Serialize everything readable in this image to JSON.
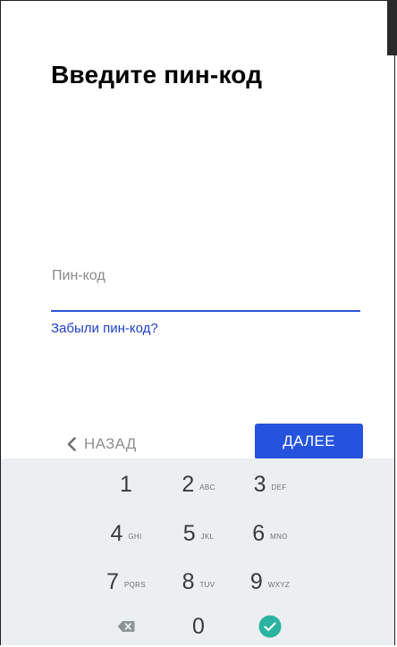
{
  "screen": {
    "title": "Введите пин-код"
  },
  "pin_field": {
    "label": "Пин-код",
    "value": ""
  },
  "forgot_link": "Забыли пин-код?",
  "nav": {
    "back_label": "НАЗАД",
    "next_label": "ДАЛЕЕ"
  },
  "keypad": {
    "keys": [
      {
        "digit": "1",
        "letters": ""
      },
      {
        "digit": "2",
        "letters": "ABC"
      },
      {
        "digit": "3",
        "letters": "DEF"
      },
      {
        "digit": "4",
        "letters": "GHI"
      },
      {
        "digit": "5",
        "letters": "JKL"
      },
      {
        "digit": "6",
        "letters": "MNO"
      },
      {
        "digit": "7",
        "letters": "PQRS"
      },
      {
        "digit": "8",
        "letters": "TUV"
      },
      {
        "digit": "9",
        "letters": "WXYZ"
      },
      {
        "digit": "0",
        "letters": ""
      }
    ],
    "delete_icon": "backspace-icon",
    "done_icon": "checkmark-circle-icon"
  },
  "colors": {
    "accent": "#2553e0",
    "link": "#1e40c9",
    "keypad_bg": "#eceff1",
    "done_green": "#2bb3a0"
  }
}
